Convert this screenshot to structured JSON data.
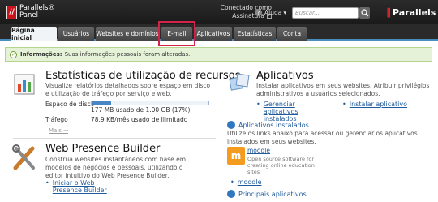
{
  "header": {
    "logo_mark": "//",
    "logo_line1": "Parallels®",
    "logo_line2": "Panel",
    "connected_line1": "Conectado como",
    "connected_line2": "Assinatura",
    "help": "Ajuda",
    "search_placeholder": "Buscar...",
    "brand": "Parallels"
  },
  "tabs": [
    {
      "label": "Página inicial",
      "active": true
    },
    {
      "label": "Usuários"
    },
    {
      "label": "Websites e domínios"
    },
    {
      "label": "E-mail"
    },
    {
      "label": "Aplicativos"
    },
    {
      "label": "Estatísticas"
    },
    {
      "label": "Conta"
    }
  ],
  "message": {
    "bold": "Informações:",
    "text": "Suas informações pessoais foram alteradas."
  },
  "stats": {
    "title": "Estatísticas de utilização de recursos",
    "desc": "Visualize relatórios detalhados sobre espaço em disco e utilização de tráfego por serviço e web.",
    "disk_label": "Espaço de disco",
    "disk_value": "177 MB usado de 1.00 GB (17%)",
    "disk_percent": 17,
    "traffic_label": "Tráfego",
    "traffic_value": "78.9 KB/mês usado de Ilimitado",
    "more": "Mais →"
  },
  "wpb": {
    "title": "Web Presence Builder",
    "desc": "Construa websites instantâneos com base em modelos de negócios e pessoais, utilizando o editor intuitivo do Web Presence Builder.",
    "link": "Iniciar o Web Presence Builder"
  },
  "apps": {
    "title": "Aplicativos",
    "desc": "Instalar aplicativos em seus websites. Atribuir privilégios administrativos a usuários selecionados.",
    "manage_link": "Gerenciar aplicativos instalados",
    "install_link": "Instalar aplicativo",
    "installed_title": "Aplicativos instalados",
    "installed_desc": "Utilize os links abaixo para acessar ou gerenciar os aplicativos instalados em seus websites.",
    "moodle_name": "moodle",
    "moodle_desc": "Open source software for creating online education sites",
    "moodle_link": "moodle",
    "main_title": "Principais aplicativos"
  }
}
